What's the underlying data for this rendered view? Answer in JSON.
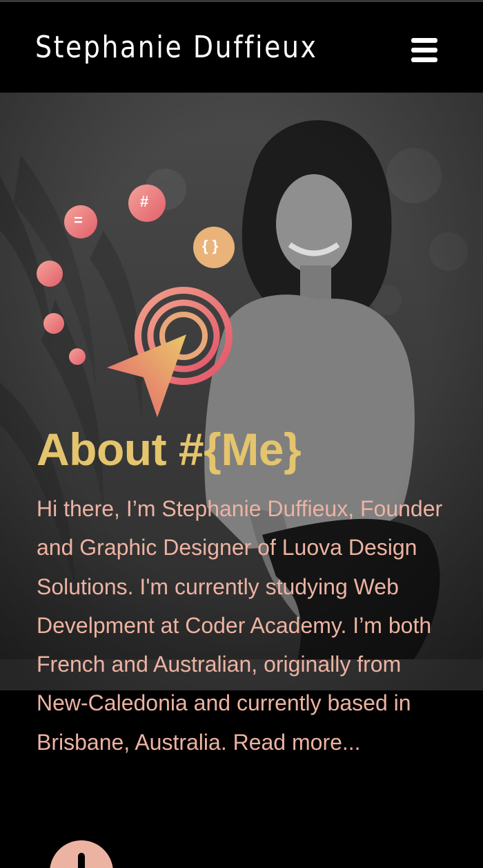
{
  "header": {
    "site_title": "Stephanie Duffieux",
    "menu_icon": "hamburger-icon"
  },
  "hero": {
    "heading": "About #{Me}",
    "bio_text": "Hi there, I’m Stephanie Duffieux, Founder and Graphic Designer of Luova Design Solutions. I'm currently studying Web Develpment at Coder Academy. I’m both French and Australian, originally from New-Caledonia and currently based in Brisbane, Australia. ",
    "read_more": "Read more...",
    "badges": {
      "equals": "=",
      "hash": "#",
      "braces": "{ }"
    }
  },
  "colors": {
    "accent_gold": "#e4c46d",
    "accent_pink": "#edb3a2",
    "coral": "#e96b6b",
    "background": "#000000"
  },
  "scroll_button": {
    "icon": "scroll-down-icon"
  }
}
